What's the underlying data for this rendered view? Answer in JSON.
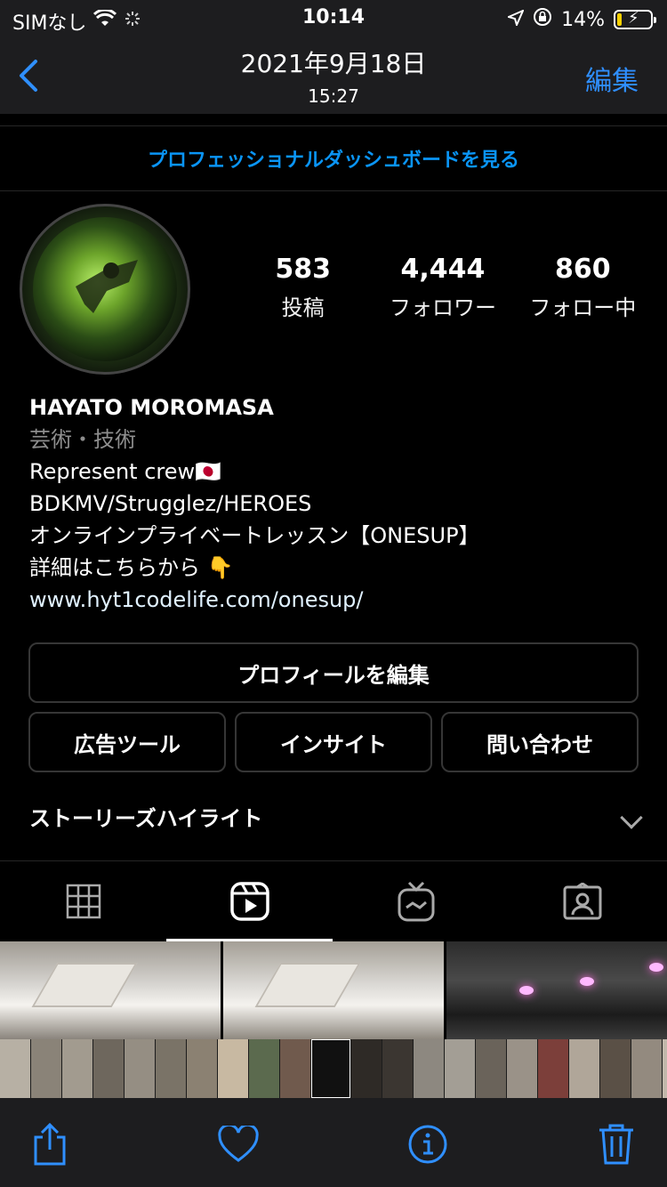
{
  "status_bar": {
    "carrier": "SIMなし",
    "time": "10:14",
    "battery": "14%",
    "battery_level": 0.14
  },
  "photos_nav": {
    "date": "2021年9月18日",
    "time": "15:27",
    "edit_label": "編集"
  },
  "instagram": {
    "pro_dashboard_link": "プロフェッショナルダッシュボードを見る",
    "stats": [
      {
        "value": "583",
        "label": "投稿"
      },
      {
        "value": "4,444",
        "label": "フォロワー"
      },
      {
        "value": "860",
        "label": "フォロー中"
      }
    ],
    "profile": {
      "name": "HAYATO MOROMASA",
      "category": "芸術・技術",
      "bio_lines": [
        "Represent crew🇯🇵",
        "BDKMV/Strugglez/HEROES",
        "オンラインプライベートレッスン【ONESUP】",
        "詳細はこちらから 👇"
      ],
      "link": "www.hyt1codelife.com/onesup/"
    },
    "buttons": {
      "edit_profile": "プロフィールを編集",
      "ad_tools": "広告ツール",
      "insights": "インサイト",
      "contact": "問い合わせ"
    },
    "highlights_label": "ストーリーズハイライト"
  },
  "icons": {
    "back": "chevron-left-icon",
    "wifi": "wifi-icon",
    "location": "location-arrow-icon",
    "lock": "orientation-lock-icon",
    "share": "share-icon",
    "favorite": "heart-icon",
    "info": "info-icon",
    "trash": "trash-icon"
  },
  "colors": {
    "accent": "#2f8fff",
    "insta_blue": "#0a95f6",
    "battery": "#f7d100"
  }
}
